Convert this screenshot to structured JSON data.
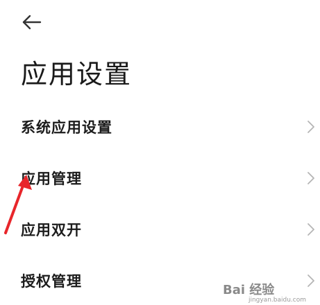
{
  "header": {
    "back_icon": "arrow-left-icon",
    "title": "应用设置"
  },
  "menu": {
    "items": [
      {
        "label": "系统应用设置",
        "icon": "chevron-right-icon"
      },
      {
        "label": "应用管理",
        "icon": "chevron-right-icon"
      },
      {
        "label": "应用双开",
        "icon": "chevron-right-icon"
      },
      {
        "label": "授权管理",
        "icon": "chevron-right-icon"
      }
    ]
  },
  "annotation": {
    "arrow_color": "#e8262b"
  },
  "watermark": {
    "text": "Bai 经验",
    "subtext": "jingyan.baidu.com"
  },
  "colors": {
    "background": "#ffffff",
    "text": "#1c1c1c",
    "chevron": "#b5b5b5"
  }
}
